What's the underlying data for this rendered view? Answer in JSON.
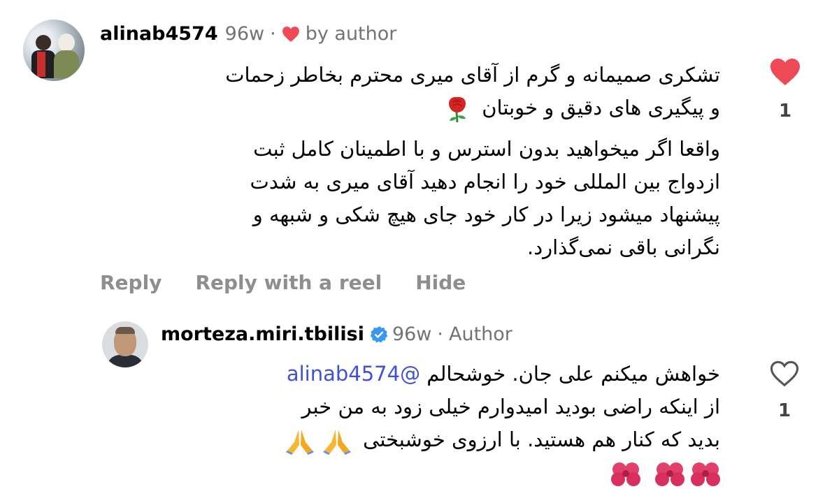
{
  "comment": {
    "username": "alinab4574",
    "age": "96w",
    "sep": "·",
    "liked_by_author": "by author",
    "lines_1": [
      "تشکری صمیمانه و گرم از آقای میری محترم بخاطر زحمات",
      "و پیگیری های دقیق و خوبتان"
    ],
    "lines_2": [
      "واقعا اگر میخواهید بدون استرس و با اطمینان کامل ثبت",
      "ازدواج بین المللی خود را انجام دهید آقای میری به شدت",
      "پیشنهاد میشود زیرا در کار خود جای هیچ شکی و شبهه و",
      "نگرانی باقی نمی‌گذارد."
    ],
    "like_count": "1",
    "liked": true,
    "accent_color": "#ed4956"
  },
  "actions": {
    "reply": "Reply",
    "reply_reel": "Reply with a reel",
    "hide": "Hide"
  },
  "reply": {
    "username": "morteza.miri.tbilisi",
    "verified": true,
    "age": "96w",
    "sep": "·",
    "role": "Author",
    "mention": "@alinab4574",
    "line_1_text": "خواهش میکنم علی جان. خوشحالم ",
    "line_2": "از اینکه راضی بودید امیدوارم خیلی زود به من خبر",
    "line_3": "بدید که کنار هم هستید. با ارزوی خوشبختی",
    "like_count": "1",
    "liked": false,
    "verified_color": "#3897f0",
    "mention_color": "#3f51d6"
  },
  "icons": {
    "liked_heart": "heart-filled-icon",
    "like_heart": "heart-outline-icon",
    "verified": "verified-badge-icon",
    "rose": "rose-emoji",
    "pray": "folded-hands-emoji",
    "hibiscus": "hibiscus-emoji"
  }
}
